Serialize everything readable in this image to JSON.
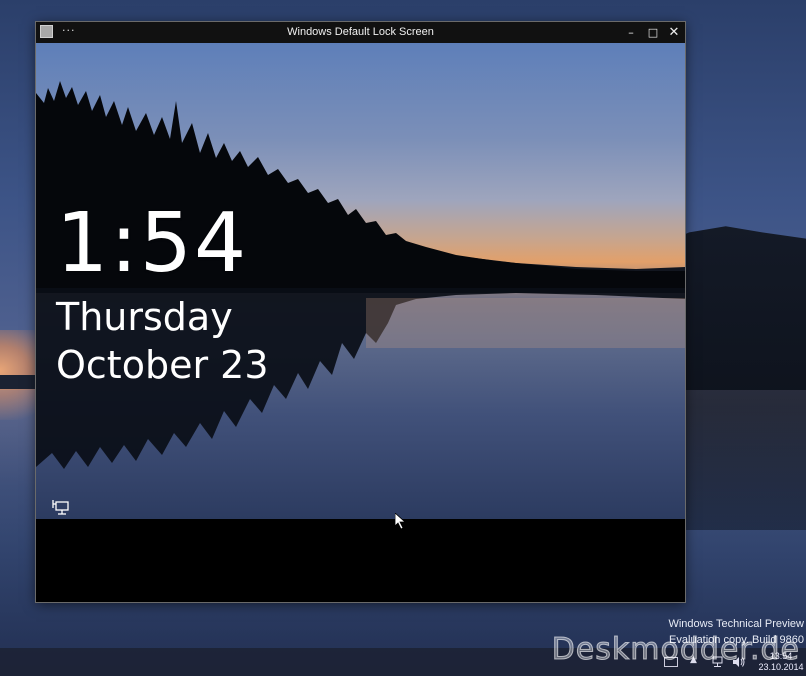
{
  "window": {
    "title": "Windows Default Lock Screen",
    "menu_glyph": "···",
    "minimize_glyph": "–",
    "maximize_glyph": "□",
    "close_glyph": "✕"
  },
  "lock_screen": {
    "time": "1:54",
    "day": "Thursday",
    "date": "October 23",
    "status_icon": "network-icon"
  },
  "desktop": {
    "watermark_line1": "Windows Technical Preview",
    "watermark_line2": "Evaluation copy. Build 9860",
    "site_logo": "Deskmodder.de"
  },
  "taskbar": {
    "tray_overflow": "▲",
    "clock_time": "13:54",
    "clock_date": "23.10.2014",
    "icons": [
      "keyboard-icon",
      "network-icon",
      "volume-icon"
    ]
  },
  "colors": {
    "title_bar": "#111111",
    "lock_text": "#ffffff",
    "sunset": "#e2a06a"
  }
}
